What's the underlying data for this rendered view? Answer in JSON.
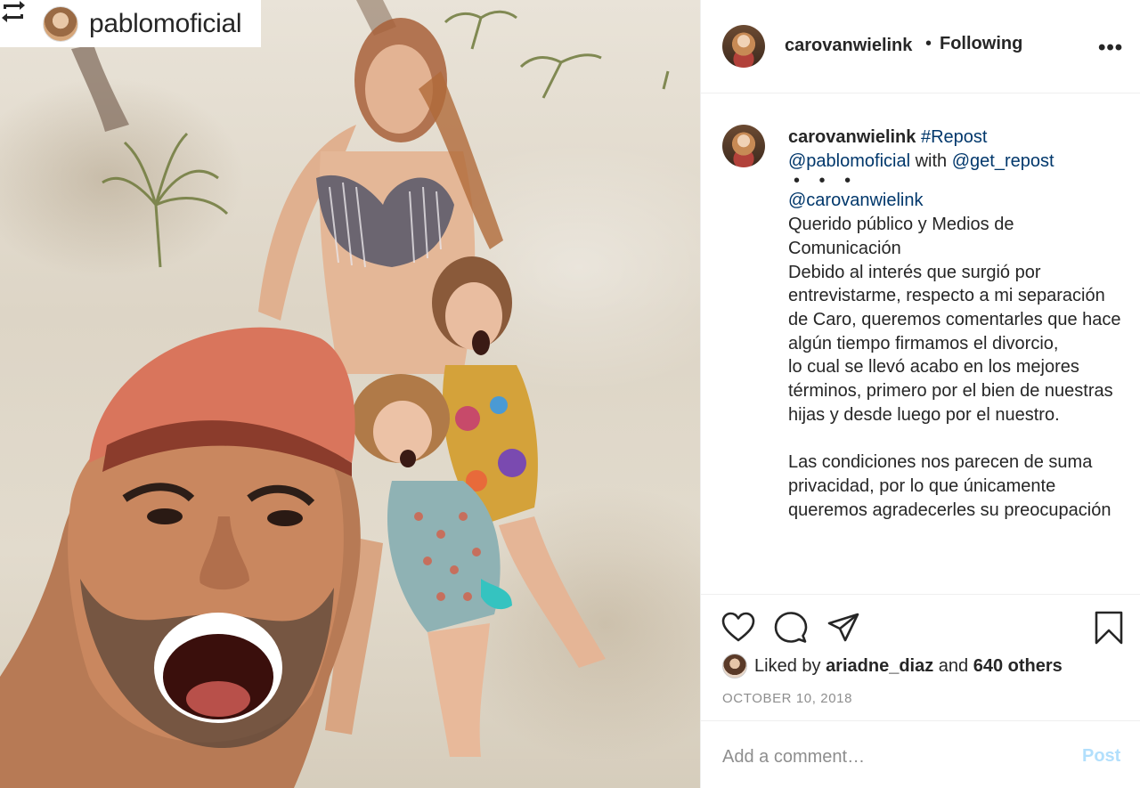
{
  "photo": {
    "repost_tag": {
      "icon": "repost-icon",
      "username": "pablomoficial"
    }
  },
  "header": {
    "username": "carovanwielink",
    "separator": "•",
    "follow_status": "Following",
    "more_icon": "more-options-icon",
    "more_label": "•••"
  },
  "caption": {
    "username": "carovanwielink",
    "hashtag": "#Repost",
    "mention_1": "@pablomoficial",
    "with_text": "with",
    "mention_2": "@get_repost",
    "dots": "• • •",
    "mention_3": "@carovanwielink",
    "lines": [
      "Querido público y Medios de Comunicación",
      "Debido al interés que surgió por entrevistarme, respecto a mi separación de Caro, queremos comentarles que hace algún tiempo firmamos el divorcio,",
      "lo cual se llevó acabo en los mejores términos, primero por el bien de nuestras hijas y desde luego por el nuestro."
    ],
    "paragraph_2": "Las condiciones nos parecen de suma privacidad, por lo que únicamente queremos agradecerles su preocupación"
  },
  "actions": {
    "icons": [
      "heart-icon",
      "comment-icon",
      "share-icon",
      "bookmark-icon"
    ],
    "likes_prefix": "Liked by",
    "likes_user": "ariadne_diaz",
    "likes_and": "and",
    "likes_others": "640 others",
    "date": "OCTOBER 10, 2018"
  },
  "comment": {
    "placeholder": "Add a comment…",
    "post_label": "Post",
    "post_color": "#b2dffc"
  },
  "colors": {
    "link": "#00376b",
    "secondary_text": "#8e8e8e",
    "divider": "#efefef"
  }
}
